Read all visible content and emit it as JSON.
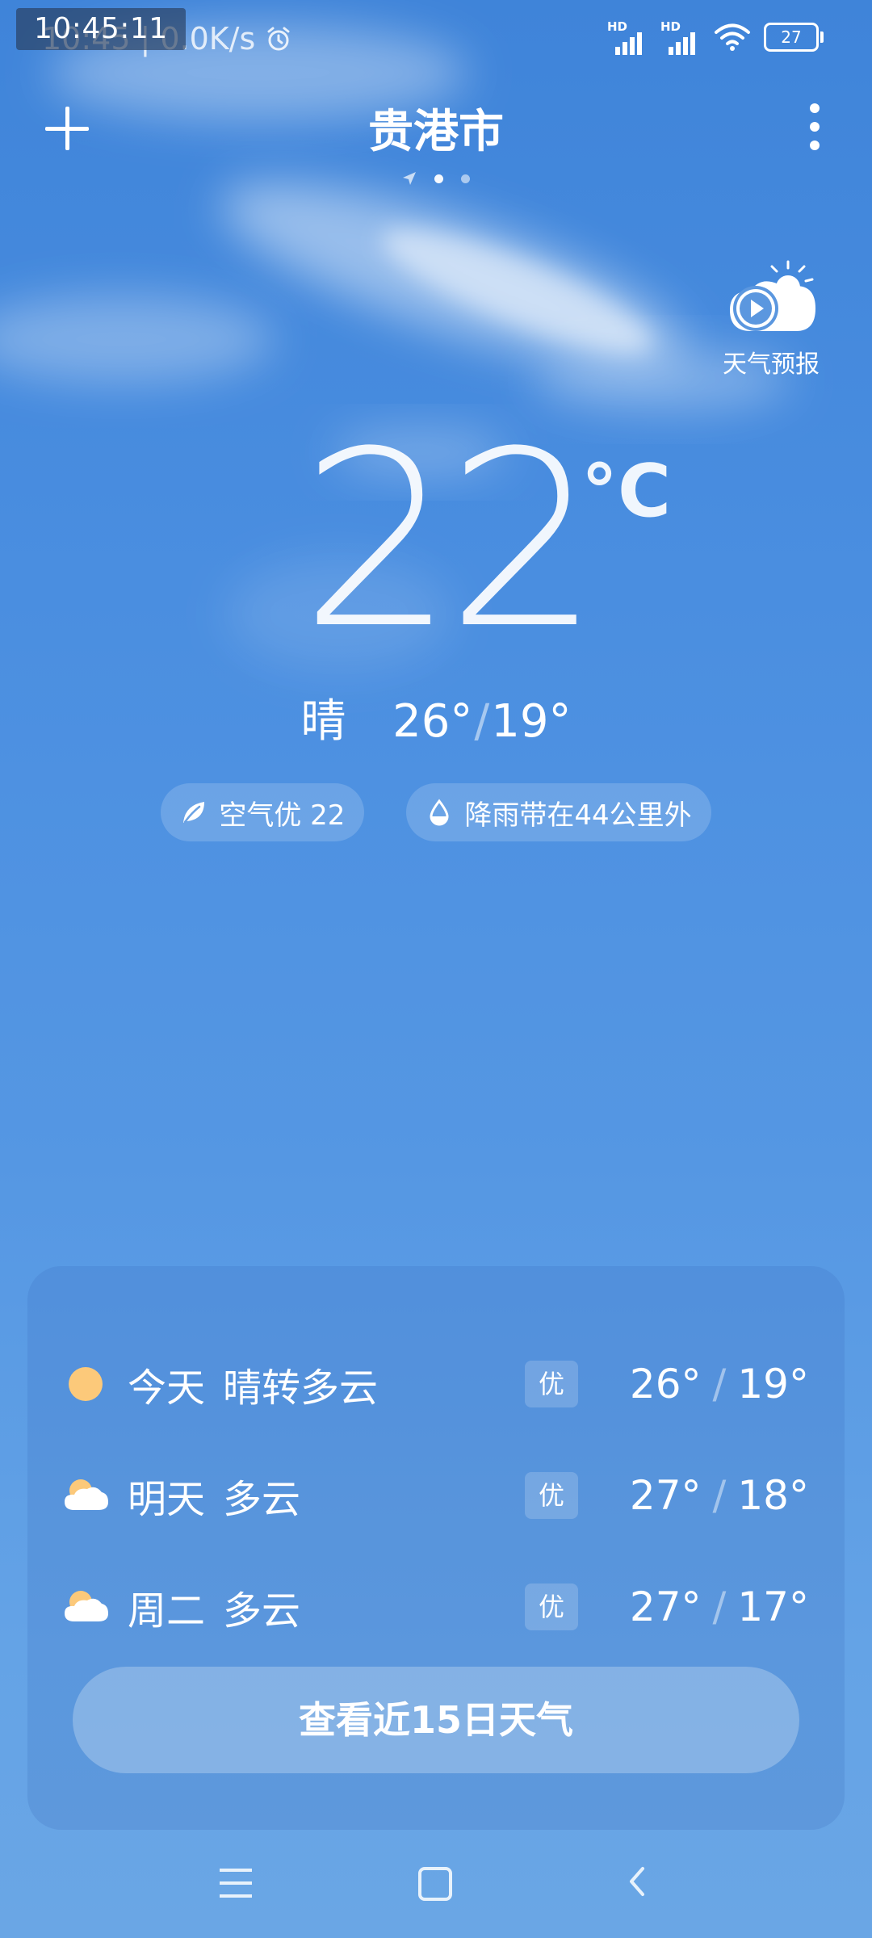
{
  "status_bar": {
    "time_overlay": "10:45:11",
    "time": "10:45",
    "net_speed": "0.0K/s",
    "signal_label": "HD",
    "battery": "27"
  },
  "header": {
    "city": "贵港市",
    "active_page": 1,
    "page_count": 2
  },
  "forecast_video": {
    "label": "天气预报"
  },
  "current": {
    "temperature": "22",
    "unit": "°C",
    "condition": "晴",
    "high": "26°",
    "low": "19°"
  },
  "pills": {
    "air": "空气优 22",
    "rain": "降雨带在44公里外"
  },
  "forecast": [
    {
      "day": "今天",
      "condition": "晴转多云",
      "aqi": "优",
      "high": "26°",
      "low": "19°",
      "icon": "sun-icon"
    },
    {
      "day": "明天",
      "condition": "多云",
      "aqi": "优",
      "high": "27°",
      "low": "18°",
      "icon": "partly-cloudy-icon"
    },
    {
      "day": "周二",
      "condition": "多云",
      "aqi": "优",
      "high": "27°",
      "low": "17°",
      "icon": "partly-cloudy-icon"
    }
  ],
  "more_button": "查看近15日天气",
  "colors": {
    "sky_top": "#3f84d9",
    "sky_bottom": "#6aa6e5",
    "sun": "#fcc97a"
  }
}
